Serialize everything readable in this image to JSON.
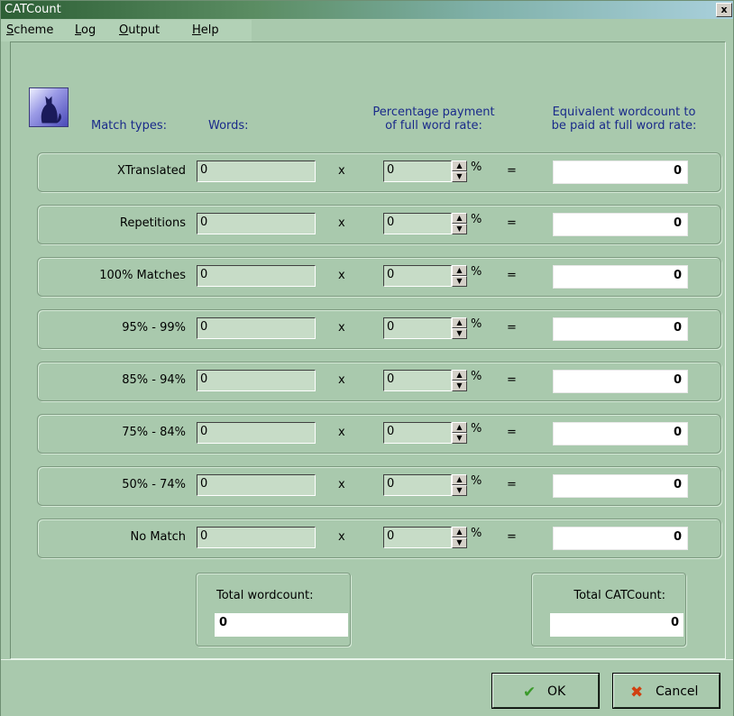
{
  "window": {
    "title": "CATCount",
    "close_glyph": "x"
  },
  "menu": [
    {
      "mnemonic": "S",
      "rest": "cheme"
    },
    {
      "mnemonic": "L",
      "rest": "og"
    },
    {
      "mnemonic": "O",
      "rest": "utput"
    },
    {
      "mnemonic": "H",
      "rest": "elp"
    }
  ],
  "headers": {
    "match_types": "Match types:",
    "words": "Words:",
    "pct_line1": "Percentage payment",
    "pct_line2": "of full word rate:",
    "equiv_line1": "Equivalent wordcount to",
    "equiv_line2": "be paid at full word rate:"
  },
  "symbols": {
    "times": "x",
    "percent": "%",
    "equals": "=",
    "spin_up": "▲",
    "spin_down": "▼"
  },
  "rows": [
    {
      "label": "XTranslated",
      "words": "0",
      "pct": "0",
      "result": "0"
    },
    {
      "label": "Repetitions",
      "words": "0",
      "pct": "0",
      "result": "0"
    },
    {
      "label": "100% Matches",
      "words": "0",
      "pct": "0",
      "result": "0"
    },
    {
      "label": "95% - 99%",
      "words": "0",
      "pct": "0",
      "result": "0"
    },
    {
      "label": "85% - 94%",
      "words": "0",
      "pct": "0",
      "result": "0"
    },
    {
      "label": "75% - 84%",
      "words": "0",
      "pct": "0",
      "result": "0"
    },
    {
      "label": "50% - 74%",
      "words": "0",
      "pct": "0",
      "result": "0"
    },
    {
      "label": "No Match",
      "words": "0",
      "pct": "0",
      "result": "0"
    }
  ],
  "totals": {
    "wordcount_label": "Total wordcount:",
    "wordcount_value": "0",
    "catcount_label": "Total CATCount:",
    "catcount_value": "0"
  },
  "buttons": {
    "ok_icon": "✔",
    "ok": "OK",
    "cancel_icon": "✖",
    "cancel": "Cancel"
  },
  "colors": {
    "ok_icon": "#3a9a2a",
    "cancel_icon": "#d04010",
    "header_text": "#1a2a8a"
  }
}
